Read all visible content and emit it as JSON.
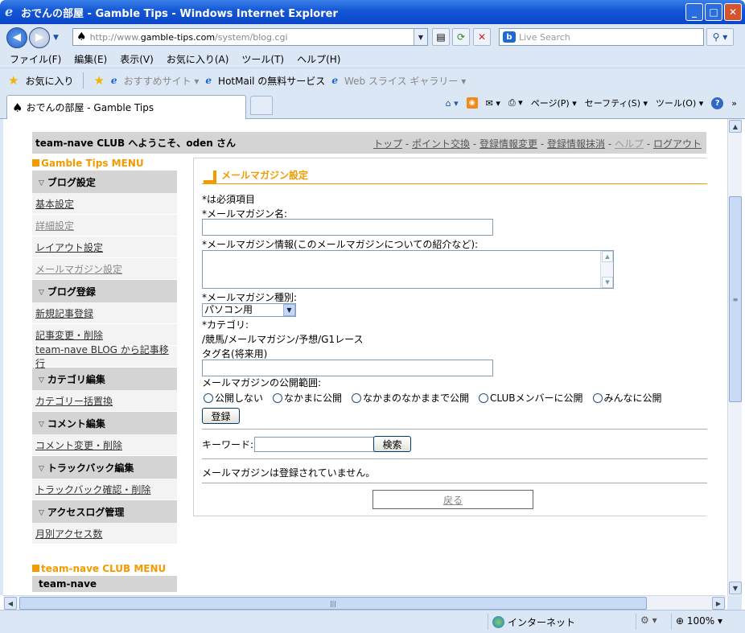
{
  "window": {
    "title": "おでんの部屋 - Gamble Tips - Windows Internet Explorer",
    "minimize": "_",
    "maximize": "□",
    "close": "✕"
  },
  "address": {
    "url_prefix": "http://www.",
    "url_domain": "gamble-tips.com",
    "url_path": "/system/blog.cgi"
  },
  "search": {
    "placeholder": "Live Search"
  },
  "menu": [
    "ファイル(F)",
    "編集(E)",
    "表示(V)",
    "お気に入り(A)",
    "ツール(T)",
    "ヘルプ(H)"
  ],
  "favorites": {
    "label": "お気に入り",
    "suggested": "おすすめサイト ▾",
    "hotmail": "HotMail の無料サービス",
    "webslice": "Web スライス ギャラリー ▾"
  },
  "tab": {
    "label": "おでんの部屋 - Gamble Tips"
  },
  "commands": {
    "page": "ページ(P) ▾",
    "safety": "セーフティ(S) ▾",
    "tools": "ツール(O) ▾"
  },
  "header": {
    "welcome": "team-nave CLUB へようこそ、oden さん",
    "links": [
      "トップ",
      "ポイント交換",
      "登録情報変更",
      "登録情報抹消",
      "ヘルプ",
      "ログアウト"
    ],
    "sep": " - "
  },
  "sidebar": {
    "menu_title": "Gamble Tips MENU",
    "sections": [
      {
        "title": "ブログ設定",
        "items": [
          "基本設定",
          "詳細設定",
          "レイアウト設定",
          "メールマガジン設定"
        ]
      },
      {
        "title": "ブログ登録",
        "items": [
          "新規記事登録",
          "記事変更・削除",
          "team-nave BLOG から記事移行"
        ]
      },
      {
        "title": "カテゴリ編集",
        "items": [
          "カテゴリー括置換"
        ]
      },
      {
        "title": "コメント編集",
        "items": [
          "コメント変更・削除"
        ]
      },
      {
        "title": "トラックバック編集",
        "items": [
          "トラックバック確認・削除"
        ]
      },
      {
        "title": "アクセスログ管理",
        "items": [
          "月別アクセス数"
        ]
      }
    ],
    "club_title": "team-nave CLUB MENU",
    "club_item": "team-nave"
  },
  "form": {
    "title": "メールマガジン設定",
    "required_note": "*は必須項目",
    "name_label": "*メールマガジン名:",
    "info_label": "*メールマガジン情報(このメールマガジンについての紹介など):",
    "type_label": "*メールマガジン種別:",
    "type_value": "パソコン用",
    "category_label": "*カテゴリ:",
    "category_value": "/競馬/メールマガジン/予想/G1レース",
    "tag_label": "タグ名(将来用)",
    "scope_label": "メールマガジンの公開範囲:",
    "scope_options": [
      "公開しない",
      "なかまに公開",
      "なかまのなかままで公開",
      "CLUBメンバーに公開",
      "みんなに公開"
    ],
    "register_button": "登録",
    "keyword_label": "キーワード:",
    "search_button": "検索",
    "empty_message": "メールマガジンは登録されていません。",
    "back_link": "戻る"
  },
  "status": {
    "zone": "インターネット",
    "zoom": "100%"
  }
}
